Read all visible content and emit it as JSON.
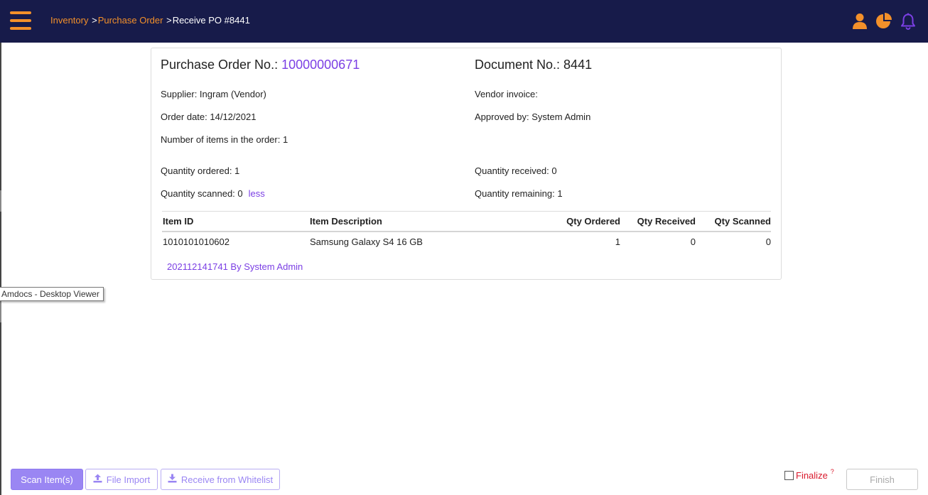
{
  "header": {
    "breadcrumb": {
      "inventory": "Inventory",
      "purchase_order": "Purchase Order",
      "separator": ">",
      "current": "Receive PO #8441"
    },
    "icons": [
      "user-icon",
      "pie-chart-icon",
      "bell-icon"
    ],
    "colors": {
      "bar": "#171b4a",
      "accent": "#f3902a",
      "bell": "#7b3fe4"
    }
  },
  "tooltip": "Amdocs - Desktop Viewer",
  "po": {
    "title_label": "Purchase Order No.:",
    "number": "10000000671",
    "document_label": "Document No.: 8441",
    "supplier": "Supplier: Ingram (Vendor)",
    "order_date": "Order date: 14/12/2021",
    "items_count": "Number of items in the order: 1",
    "vendor_invoice": "Vendor invoice:",
    "approved_by": "Approved by: System Admin",
    "qty_ordered": "Quantity ordered: 1",
    "qty_scanned": "Quantity scanned: 0",
    "less_link": "less",
    "qty_received": "Quantity received: 0",
    "qty_remaining": "Quantity remaining: 1"
  },
  "table": {
    "columns": [
      "Item ID",
      "Item Description",
      "Qty Ordered",
      "Qty Received",
      "Qty Scanned"
    ],
    "rows": [
      [
        "1010101010602",
        "Samsung Galaxy S4 16 GB",
        "1",
        "0",
        "0"
      ]
    ],
    "scan_log": "202112141741 By System Admin"
  },
  "footer": {
    "scan_items": "Scan Item(s)",
    "file_import": "File Import",
    "receive_whitelist": "Receive from Whitelist",
    "finalize": "Finalize",
    "help_mark": "?",
    "finish": "Finish",
    "colors": {
      "primary": "#9a86f3",
      "finalize": "#d9192c"
    }
  }
}
